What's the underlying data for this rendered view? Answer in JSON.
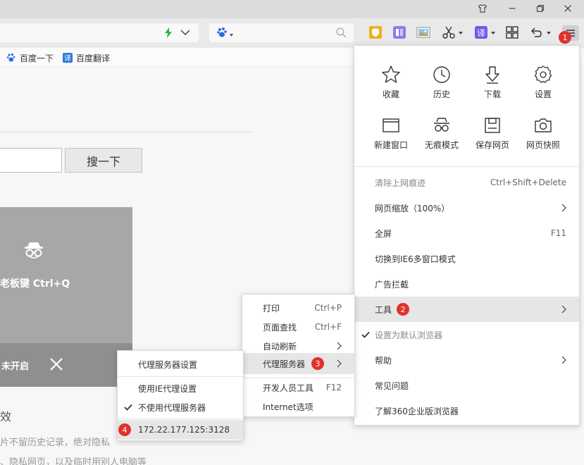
{
  "bookmarks": [
    {
      "label": "百度一下",
      "icon": "baidu-paw-icon"
    },
    {
      "label": "百度翻译",
      "icon": "translate-icon"
    }
  ],
  "page": {
    "search_button": "搜一下",
    "card_shortcut": "老板键 Ctrl+Q",
    "card_status": "未开启",
    "heading": "效",
    "line1": "片不留历史记录，绝对隐私",
    "line2": "、隐私网页，以及临时用别人电脑等"
  },
  "main_menu": {
    "grid": [
      {
        "label": "收藏",
        "icon": "star-icon"
      },
      {
        "label": "历史",
        "icon": "clock-icon"
      },
      {
        "label": "下载",
        "icon": "download-icon"
      },
      {
        "label": "设置",
        "icon": "gear-icon"
      },
      {
        "label": "新建窗口",
        "icon": "window-icon"
      },
      {
        "label": "无痕模式",
        "icon": "incognito-icon"
      },
      {
        "label": "保存网页",
        "icon": "save-icon"
      },
      {
        "label": "网页快照",
        "icon": "camera-icon"
      }
    ],
    "items": [
      {
        "label": "清除上网痕迹",
        "shortcut": "Ctrl+Shift+Delete"
      },
      {
        "label": "网页缩放（100%）",
        "shortcut": ""
      },
      {
        "label": "全屏",
        "shortcut": "F11"
      },
      {
        "label": "切换到IE6多窗口模式",
        "shortcut": ""
      },
      {
        "label": "广告拦截",
        "shortcut": ""
      },
      {
        "label": "工具",
        "shortcut": ""
      },
      {
        "label": "设置为默认浏览器",
        "shortcut": ""
      },
      {
        "label": "帮助",
        "shortcut": ""
      },
      {
        "label": "常见问题",
        "shortcut": ""
      },
      {
        "label": "了解360企业版浏览器",
        "shortcut": ""
      }
    ]
  },
  "tools_menu": {
    "items": [
      {
        "label": "打印",
        "shortcut": "Ctrl+P"
      },
      {
        "label": "页面查找",
        "shortcut": "Ctrl+F"
      },
      {
        "label": "自动刷新",
        "shortcut": ""
      },
      {
        "label": "代理服务器",
        "shortcut": ""
      },
      {
        "label": "开发人员工具",
        "shortcut": "F12"
      },
      {
        "label": "Internet选项",
        "shortcut": ""
      }
    ]
  },
  "proxy_menu": {
    "items": [
      {
        "label": "代理服务器设置"
      },
      {
        "label": "使用IE代理设置"
      },
      {
        "label": "不使用代理服务器"
      },
      {
        "label": "172.22.177.125:3128"
      }
    ]
  },
  "badges": [
    "1",
    "2",
    "3",
    "4"
  ],
  "colors": {
    "badge": "#e0312b",
    "highlight": "#e6e6e6",
    "lightning": "#2bb34a",
    "shield": "#f2b01e",
    "translate": "#7a56e8"
  }
}
